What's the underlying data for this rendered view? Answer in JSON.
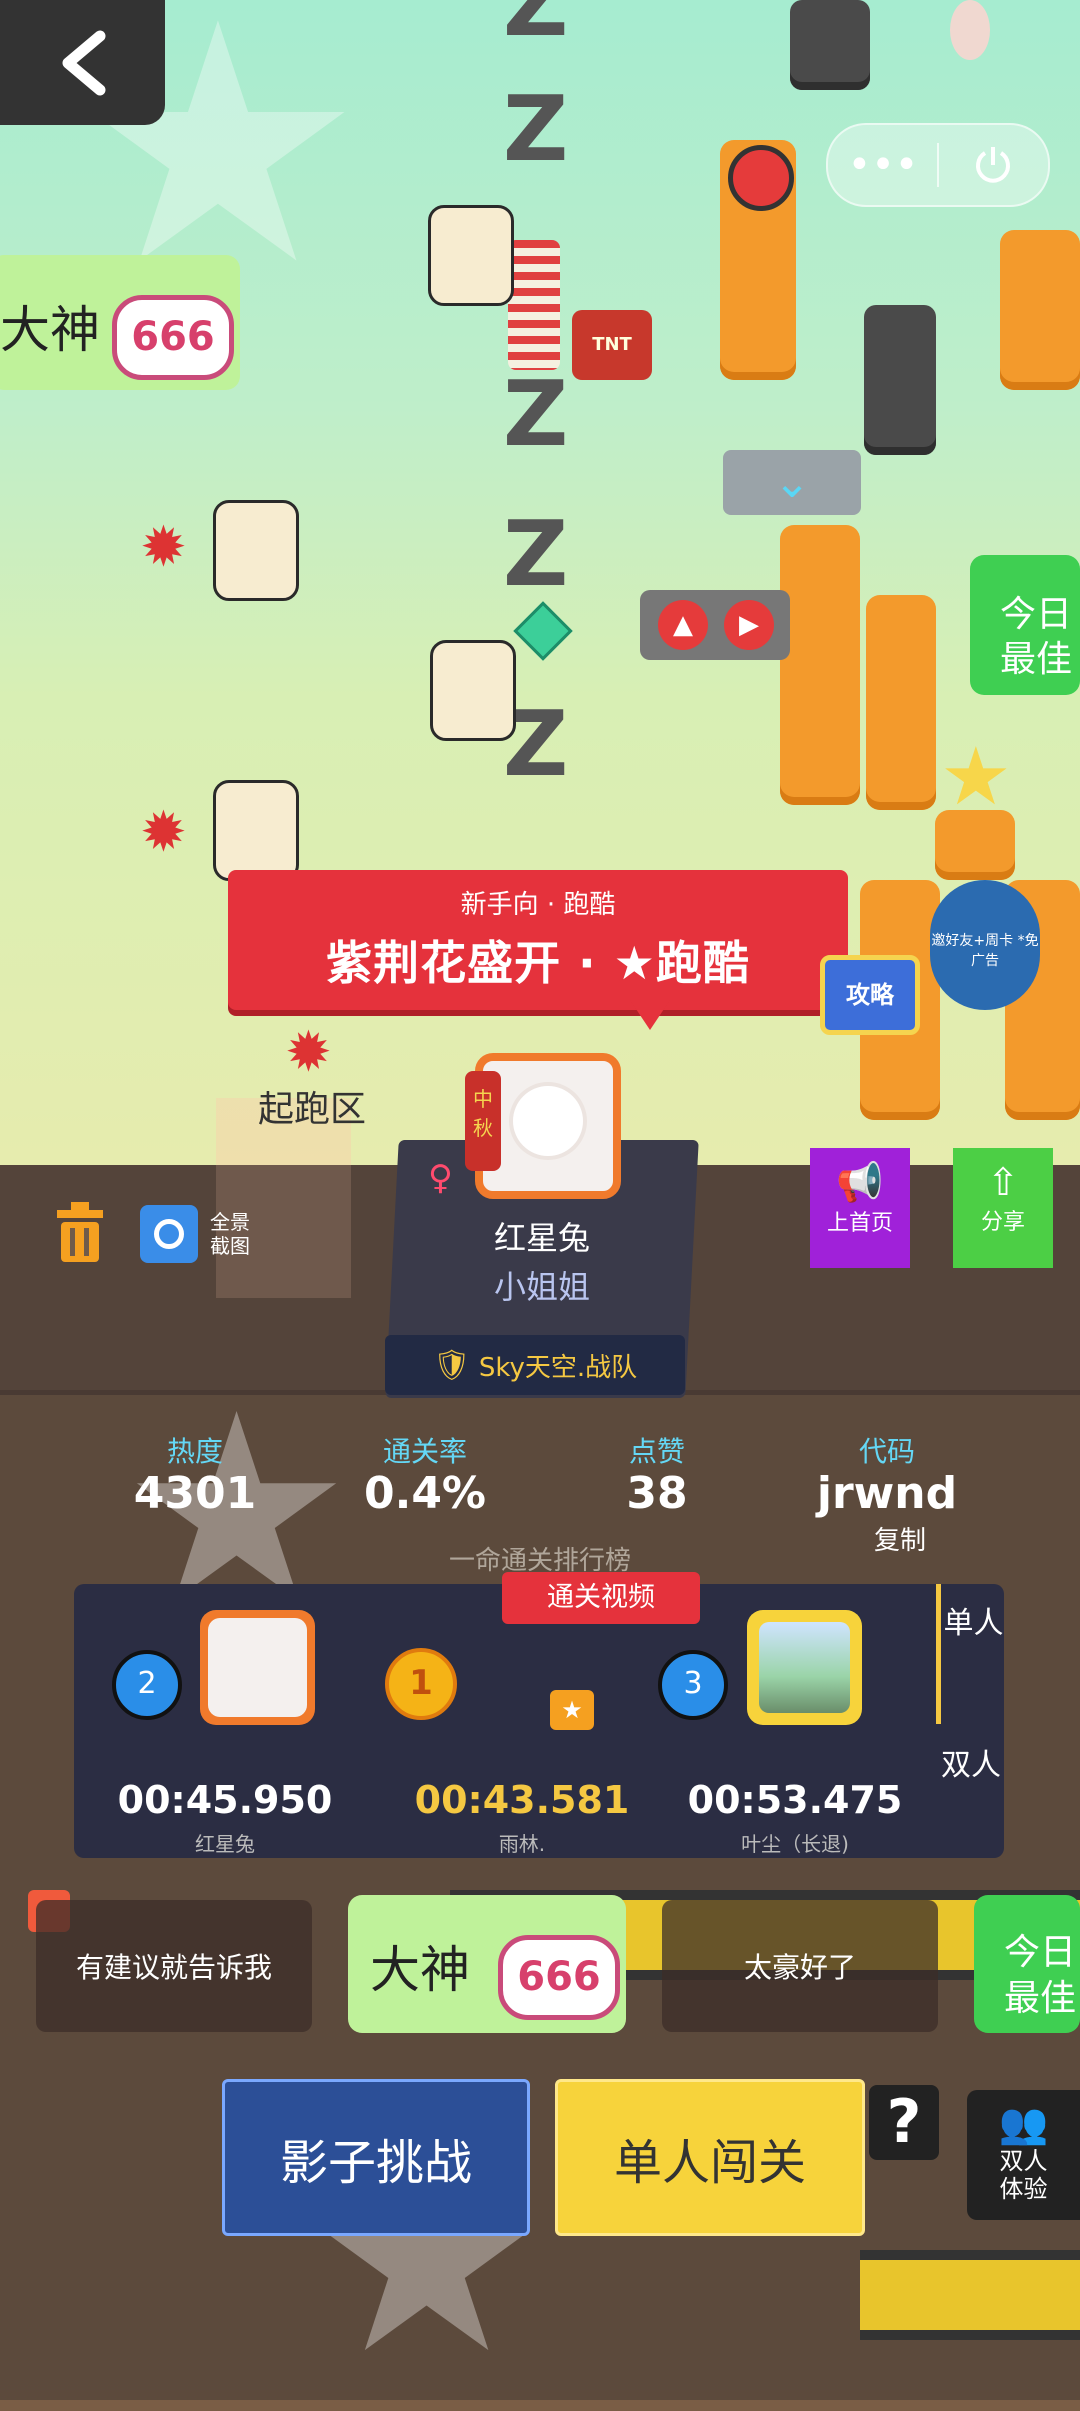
{
  "banner": {
    "subtitle": "新手向 · 跑酷",
    "title": "紫荆花盛开 · ★跑酷"
  },
  "guide_label": "攻略",
  "invite_label": "邀好友+周卡\n*免广告",
  "start_zone_label": "起跑区",
  "author": {
    "name": "红星兔",
    "title": "小姐姐",
    "team": "Sky天空.战队",
    "gender_symbol": "♀"
  },
  "screenshot_label": "全景截图",
  "promote_label": "上首页",
  "share_label": "分享",
  "stats": [
    {
      "label": "热度",
      "value": "4301"
    },
    {
      "label": "通关率",
      "value": "0.4%"
    },
    {
      "label": "点赞",
      "value": "38"
    },
    {
      "label": "代码",
      "value": "jrwnd"
    }
  ],
  "copy_label": "复制",
  "leaderboard": {
    "title": "一命通关排行榜",
    "video_tag": "通关视频",
    "tab_single": "单人",
    "tab_double": "双人",
    "entries": [
      {
        "rank": "2",
        "time": "00:45.950",
        "name": "红星兔"
      },
      {
        "rank": "1",
        "time": "00:43.581",
        "name": "雨林."
      },
      {
        "rank": "3",
        "time": "00:53.475",
        "name": "叶尘（长退)"
      }
    ]
  },
  "comments": [
    "有建议就告诉我",
    "太豪好了"
  ],
  "stickers": {
    "dashen": "大神",
    "badge": "666",
    "today_best_1": "今日",
    "today_best_2": "最佳"
  },
  "buttons": {
    "shadow": "影子挑战",
    "solo": "单人闯关",
    "help": "?",
    "duo": "双人体验"
  },
  "colors": {
    "accent_red": "#e5323c",
    "solo_yellow": "#f7d33b",
    "shadow_blue": "#2c4f97",
    "time_gold": "#f5c842"
  }
}
